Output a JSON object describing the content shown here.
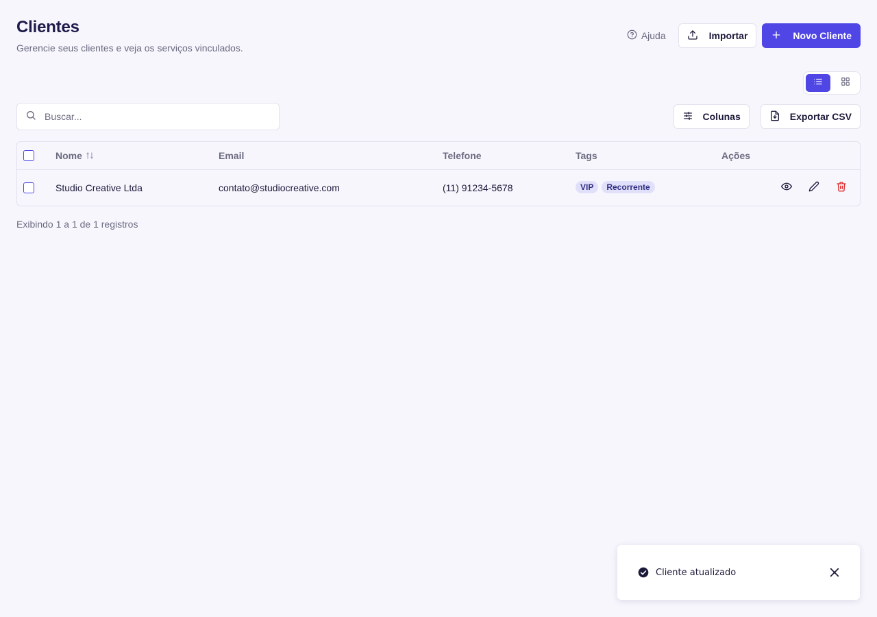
{
  "header": {
    "title": "Clientes",
    "subtitle": "Gerencie seus clientes e veja os serviços vinculados.",
    "help_label": "Ajuda",
    "import_label": "Importar",
    "new_client_label": "Novo Cliente"
  },
  "view_toggle": {
    "active": "list"
  },
  "search": {
    "placeholder": "Buscar...",
    "value": ""
  },
  "table_tools": {
    "columns_label": "Colunas",
    "export_label": "Exportar CSV"
  },
  "table": {
    "headers": {
      "name": "Nome",
      "email": "Email",
      "phone": "Telefone",
      "tags": "Tags",
      "actions": "Ações"
    },
    "rows": [
      {
        "name": "Studio Creative Ltda",
        "email": "contato@studiocreative.com",
        "phone": "(11) 91234-5678",
        "tags": [
          "VIP",
          "Recorrente"
        ]
      }
    ]
  },
  "footer": {
    "count_text": "Exibindo 1 a 1 de 1 registros"
  },
  "toast": {
    "message": "Cliente atualizado"
  },
  "colors": {
    "accent": "#4f46e5",
    "danger": "#dc2626",
    "background": "#f7f6fd"
  }
}
